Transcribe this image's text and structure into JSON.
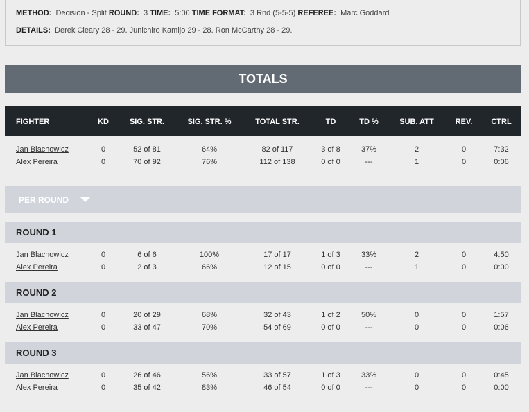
{
  "details_box": {
    "method_label": "METHOD:",
    "method_value": "Decision - Split",
    "round_label": "ROUND:",
    "round_value": "3",
    "time_label": "TIME:",
    "time_value": "5:00",
    "time_format_label": "TIME FORMAT:",
    "time_format_value": "3 Rnd (5-5-5)",
    "referee_label": "REFEREE:",
    "referee_value": "Marc Goddard",
    "details_label": "DETAILS:",
    "details_value": "Derek Cleary 28 - 29. Junichiro Kamijo 29 - 28. Ron McCarthy 28 - 29."
  },
  "totals_title": "TOTALS",
  "columns": [
    "FIGHTER",
    "KD",
    "SIG. STR.",
    "SIG. STR. %",
    "TOTAL STR.",
    "TD",
    "TD %",
    "SUB. ATT",
    "REV.",
    "CTRL"
  ],
  "totals": [
    [
      "Jan Blachowicz",
      "0",
      "52 of 81",
      "64%",
      "82 of 117",
      "3 of 8",
      "37%",
      "2",
      "0",
      "7:32"
    ],
    [
      "Alex Pereira",
      "0",
      "70 of 92",
      "76%",
      "112 of 138",
      "0 of 0",
      "---",
      "1",
      "0",
      "0:06"
    ]
  ],
  "per_round_label": "PER ROUND",
  "rounds": [
    {
      "title": "ROUND 1",
      "rows": [
        [
          "Jan Blachowicz",
          "0",
          "6 of 6",
          "100%",
          "17 of 17",
          "1 of 3",
          "33%",
          "2",
          "0",
          "4:50"
        ],
        [
          "Alex Pereira",
          "0",
          "2 of 3",
          "66%",
          "12 of 15",
          "0 of 0",
          "---",
          "1",
          "0",
          "0:00"
        ]
      ]
    },
    {
      "title": "ROUND 2",
      "rows": [
        [
          "Jan Blachowicz",
          "0",
          "20 of 29",
          "68%",
          "32 of 43",
          "1 of 2",
          "50%",
          "0",
          "0",
          "1:57"
        ],
        [
          "Alex Pereira",
          "0",
          "33 of 47",
          "70%",
          "54 of 69",
          "0 of 0",
          "---",
          "0",
          "0",
          "0:06"
        ]
      ]
    },
    {
      "title": "ROUND 3",
      "rows": [
        [
          "Jan Blachowicz",
          "0",
          "26 of 46",
          "56%",
          "33 of 57",
          "1 of 3",
          "33%",
          "0",
          "0",
          "0:45"
        ],
        [
          "Alex Pereira",
          "0",
          "35 of 42",
          "83%",
          "46 of 54",
          "0 of 0",
          "---",
          "0",
          "0",
          "0:00"
        ]
      ]
    }
  ]
}
